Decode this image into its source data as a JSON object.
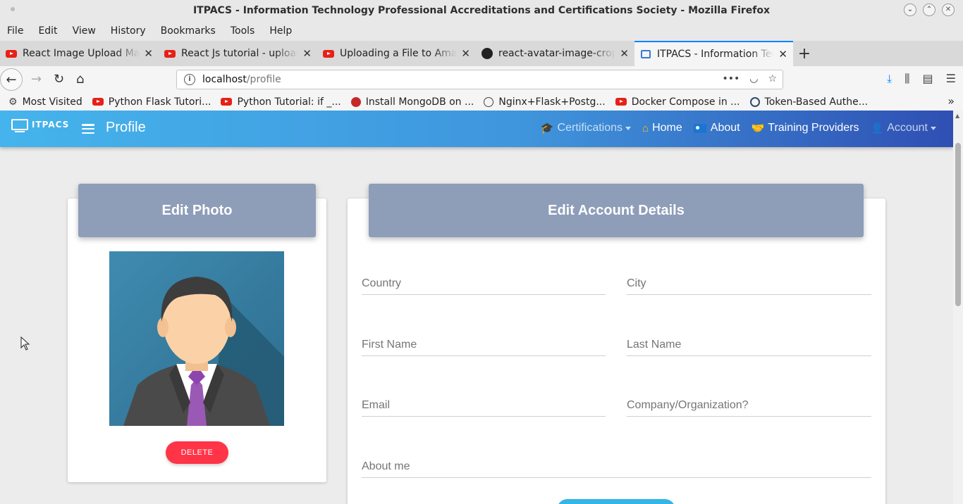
{
  "window": {
    "title": "ITPACS - Information Technology Professional Accreditations and Certifications Society - Mozilla Firefox",
    "controls": [
      "⌄",
      "⌃",
      "✕"
    ]
  },
  "menu": [
    "File",
    "Edit",
    "View",
    "History",
    "Bookmarks",
    "Tools",
    "Help"
  ],
  "tabs": [
    {
      "label": "React Image Upload Made",
      "icon": "youtube-icon"
    },
    {
      "label": "React Js tutorial - upload",
      "icon": "youtube-icon"
    },
    {
      "label": "Uploading a File to Amaz",
      "icon": "youtube-icon"
    },
    {
      "label": "react-avatar-image-cropp",
      "icon": "github-icon"
    },
    {
      "label": "ITPACS - Information Tech",
      "icon": "itpacs-icon"
    }
  ],
  "url": {
    "host": "localhost",
    "path": "/profile"
  },
  "bookmarks": [
    {
      "label": "Most Visited",
      "icon": "gear-icon"
    },
    {
      "label": "Python Flask Tutori...",
      "icon": "youtube-icon"
    },
    {
      "label": "Python Tutorial: if _...",
      "icon": "youtube-icon"
    },
    {
      "label": "Install MongoDB on ...",
      "icon": "mongo-icon"
    },
    {
      "label": "Nginx+Flask+Postg...",
      "icon": "globe-icon"
    },
    {
      "label": "Docker Compose in ...",
      "icon": "youtube-icon"
    },
    {
      "label": "Token-Based Authe...",
      "icon": "token-icon"
    }
  ],
  "app": {
    "brand": "ITPACS",
    "page_title": "Profile",
    "nav": {
      "certifications": "Certifications",
      "home": "Home",
      "about": "About",
      "training": "Training Providers",
      "account": "Account"
    }
  },
  "photo_card": {
    "title": "Edit Photo",
    "delete_label": "DELETE"
  },
  "account_card": {
    "title": "Edit Account Details",
    "fields": {
      "country": {
        "placeholder": "Country",
        "value": ""
      },
      "city": {
        "placeholder": "City",
        "value": ""
      },
      "first_name": {
        "placeholder": "First Name",
        "value": ""
      },
      "last_name": {
        "placeholder": "Last Name",
        "value": ""
      },
      "email": {
        "placeholder": "Email",
        "value": ""
      },
      "company": {
        "placeholder": "Company/Organization?",
        "value": ""
      },
      "about": {
        "placeholder": "About me",
        "value": ""
      }
    }
  },
  "colors": {
    "appbar_start": "#45b4ec",
    "appbar_end": "#2f4fb3",
    "card_header": "#8e9db8",
    "delete_button": "#ff3547",
    "submit_button": "#33b5e5"
  }
}
